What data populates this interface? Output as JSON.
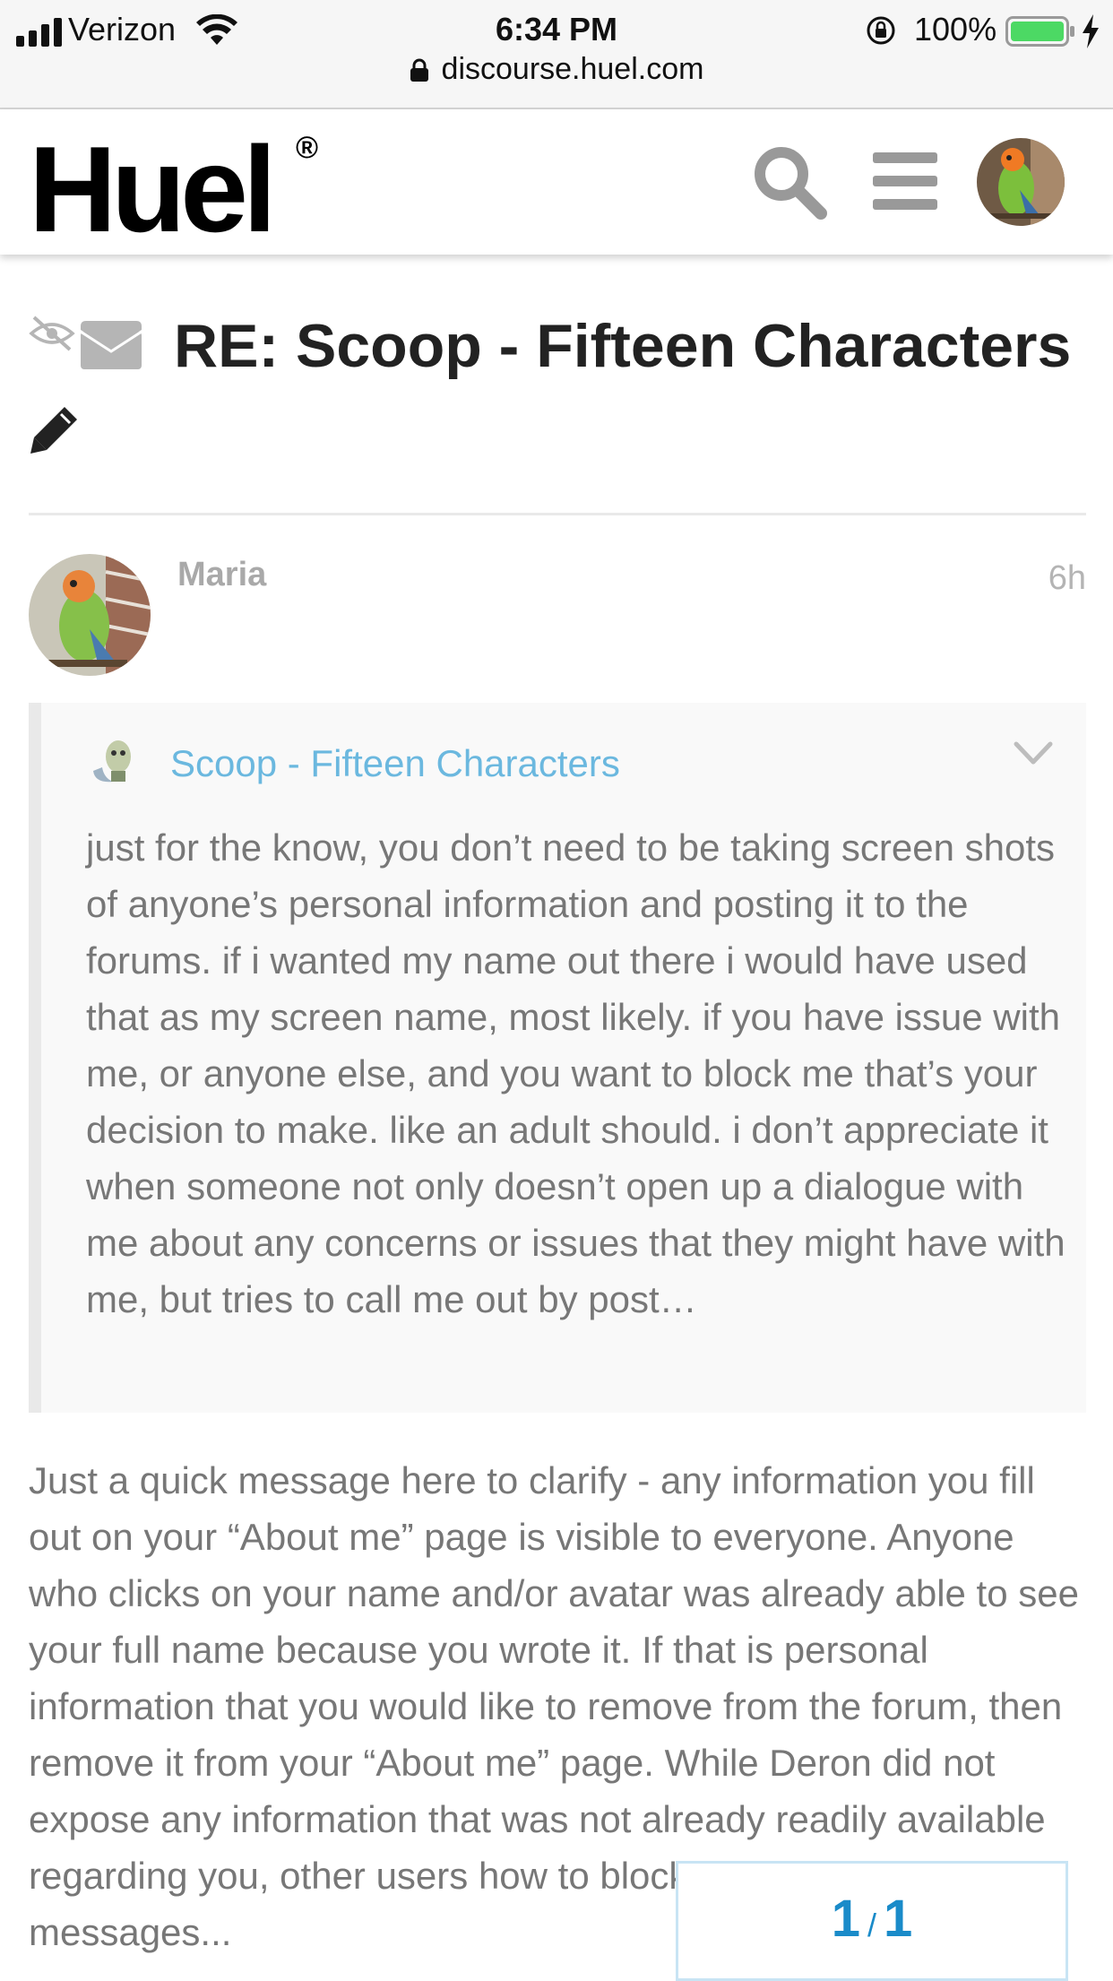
{
  "status_bar": {
    "carrier": "Verizon",
    "time": "6:34 PM",
    "battery": "100%",
    "battery_level": 1.0,
    "url": "discourse.huel.com",
    "icons": [
      "signal-icon",
      "wifi-icon",
      "rotation-lock-icon",
      "battery-icon",
      "charging-bolt-icon",
      "url-lock-icon"
    ]
  },
  "header": {
    "logo": "Huel",
    "logo_mark": "®",
    "icons": [
      "search-icon",
      "hamburger-menu-icon",
      "user-avatar"
    ]
  },
  "topic": {
    "title": "RE: Scoop - Fifteen Characters",
    "icons": [
      "eye-off-icon",
      "envelope-icon",
      "pencil-icon"
    ]
  },
  "post": {
    "author": "Maria",
    "age": "6h",
    "quote": {
      "title": "Scoop - Fifteen Characters",
      "text": "just for the know, you don’t need to be taking screen shots of anyone’s personal information and posting it to the forums. if i wanted my name out there i would have used that as my screen name, most likely. if you have issue with me, or anyone else, and you want to block me that’s your decision to make. like an adult should. i don’t appreciate it when someone not only doesn’t open up a dialogue with me about any concerns or issues that they might have with me, but tries to call me out by post…"
    },
    "body": "Just a quick message here to clarify - any information you fill out on your “About me” page is visible to everyone. Anyone who clicks on your name and/or avatar was already able to see your full name because you wrote it. If that is personal information that you would like to remove from the forum, then remove it from your “About me” page. While Deron did not expose any information that was not already readily available regarding you, other users how to block you and your messages..."
  },
  "progress": {
    "current": "1",
    "separator": "/",
    "total": "1"
  },
  "colors": {
    "link": "#6bb8df",
    "accent": "#1a8bc9",
    "muted_text": "#777777",
    "quote_bg": "#f9f9f9"
  }
}
